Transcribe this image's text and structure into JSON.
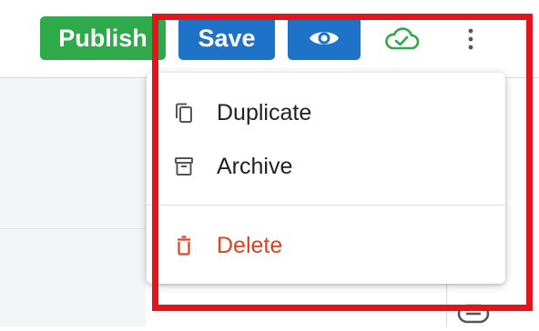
{
  "toolbar": {
    "publish_label": "Publish",
    "save_label": "Save",
    "preview_icon": "eye-icon",
    "cloud_icon": "cloud-check-icon",
    "more_icon": "more-vertical-icon"
  },
  "menu": {
    "items": [
      {
        "label": "Duplicate",
        "icon": "copy-icon"
      },
      {
        "label": "Archive",
        "icon": "archive-icon"
      },
      {
        "label": "Delete",
        "icon": "trash-icon"
      }
    ]
  },
  "colors": {
    "publish": "#2eaa4a",
    "primary": "#1e73c8",
    "cloud_status": "#2eaa4a",
    "danger": "#d9431e",
    "highlight": "#e3141c"
  }
}
